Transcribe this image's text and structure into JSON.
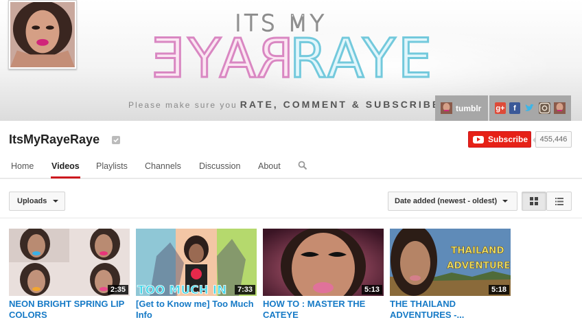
{
  "banner": {
    "top_text": "ITS MY",
    "logo_left": "RAYE",
    "logo_right": "RAYE",
    "tagline_prefix": "Please make sure you",
    "tagline_bold": "RATE, COMMENT & SUBSCRIBE",
    "tumblr_label": "tumblr",
    "social_icons": [
      "google-plus-icon",
      "facebook-icon",
      "twitter-icon",
      "instagram-icon",
      "avatar-link-icon"
    ]
  },
  "channel": {
    "name": "ItsMyRayeRaye",
    "subscribe_label": "Subscribe",
    "subscriber_count": "455,446"
  },
  "tabs": [
    {
      "label": "Home",
      "active": false
    },
    {
      "label": "Videos",
      "active": true
    },
    {
      "label": "Playlists",
      "active": false
    },
    {
      "label": "Channels",
      "active": false
    },
    {
      "label": "Discussion",
      "active": false
    },
    {
      "label": "About",
      "active": false
    }
  ],
  "toolbar": {
    "uploads_label": "Uploads",
    "sort_label": "Date added (newest - oldest)"
  },
  "videos": [
    {
      "title": "NEON BRIGHT SPRING LIP COLORS",
      "duration": "2:35"
    },
    {
      "title": "[Get to Know me] Too Much Info",
      "duration": "7:33",
      "overlay_text": "TOO MUCH IN"
    },
    {
      "title": "HOW TO : MASTER THE CATEYE",
      "duration": "5:13"
    },
    {
      "title": "THE THAILAND ADVENTURES -...",
      "duration": "5:18",
      "overlay_line1": "THAILAND",
      "overlay_line2": "ADVENTURES"
    }
  ],
  "colors": {
    "accent_red": "#e62117",
    "link_blue": "#167ac6",
    "logo_pink": "#d987c2",
    "logo_blue": "#73c9dc"
  }
}
